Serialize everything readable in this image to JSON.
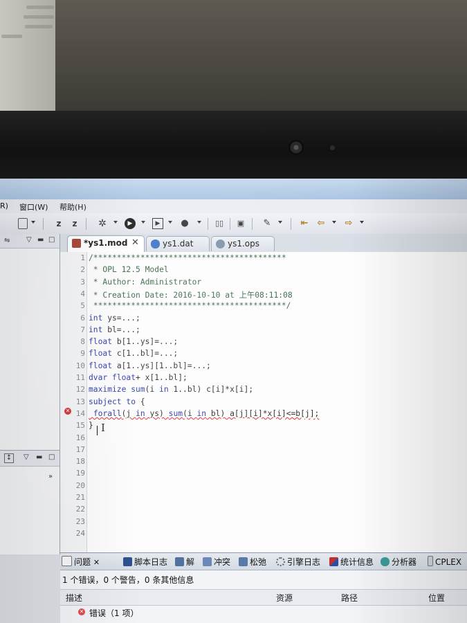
{
  "menu": {
    "items": [
      {
        "label": "R)"
      },
      {
        "label": "窗口(W)"
      },
      {
        "label": "帮助(H)"
      }
    ]
  },
  "toolbar": {
    "z1": "z",
    "z2": "z"
  },
  "tabs": [
    {
      "label": "*ys1.mod",
      "active": true,
      "close": "✕"
    },
    {
      "label": "ys1.dat",
      "active": false
    },
    {
      "label": "ys1.ops",
      "active": false
    }
  ],
  "editor": {
    "lines": [
      {
        "n": "1",
        "text": "/*****************************************"
      },
      {
        "n": "2",
        "text": " * OPL 12.5 Model"
      },
      {
        "n": "3",
        "text": " * Author: Administrator"
      },
      {
        "n": "4",
        "text": " * Creation Date: 2016-10-10 at 上午08:11:08"
      },
      {
        "n": "5",
        "text": " *****************************************/"
      },
      {
        "n": "6",
        "text": "int ys=...;"
      },
      {
        "n": "7",
        "text": "int bl=...;"
      },
      {
        "n": "8",
        "text": "float b[1..ys]=...;"
      },
      {
        "n": "9",
        "text": "float c[1..bl]=...;"
      },
      {
        "n": "10",
        "text": "float a[1..ys][1..bl]=...;"
      },
      {
        "n": "11",
        "text": "dvar float+ x[1..bl];"
      },
      {
        "n": "12",
        "text": "maximize sum(i in 1..bl) c[i]*x[i];"
      },
      {
        "n": "13",
        "text": "subject to {"
      },
      {
        "n": "14",
        "text": " forall(j in ys) sum(i in bl) a[j][i]*x[i]<=b[j];"
      },
      {
        "n": "15",
        "text": "}"
      },
      {
        "n": "16",
        "text": ""
      },
      {
        "n": "17",
        "text": ""
      },
      {
        "n": "18",
        "text": ""
      },
      {
        "n": "19",
        "text": ""
      },
      {
        "n": "20",
        "text": ""
      },
      {
        "n": "21",
        "text": ""
      },
      {
        "n": "22",
        "text": ""
      },
      {
        "n": "23",
        "text": ""
      },
      {
        "n": "24",
        "text": ""
      }
    ]
  },
  "problems": {
    "tabs": [
      {
        "label": "问题",
        "close": "✕"
      },
      {
        "label": "脚本日志"
      },
      {
        "label": "解"
      },
      {
        "label": "冲突"
      },
      {
        "label": "松弛"
      },
      {
        "label": "引擎日志"
      },
      {
        "label": "统计信息"
      },
      {
        "label": "分析器"
      },
      {
        "label": "CPLEX"
      }
    ],
    "summary": "1 个错误，0 个警告，0 条其他信息",
    "columns": [
      "描述",
      "资源",
      "路径",
      "位置"
    ],
    "rows": [
      {
        "label": "错误（1 项）"
      }
    ]
  },
  "colors": {
    "keyword": "#1f2fa8",
    "error": "#d62a2a",
    "editor_bg": "#fdfdfd"
  }
}
